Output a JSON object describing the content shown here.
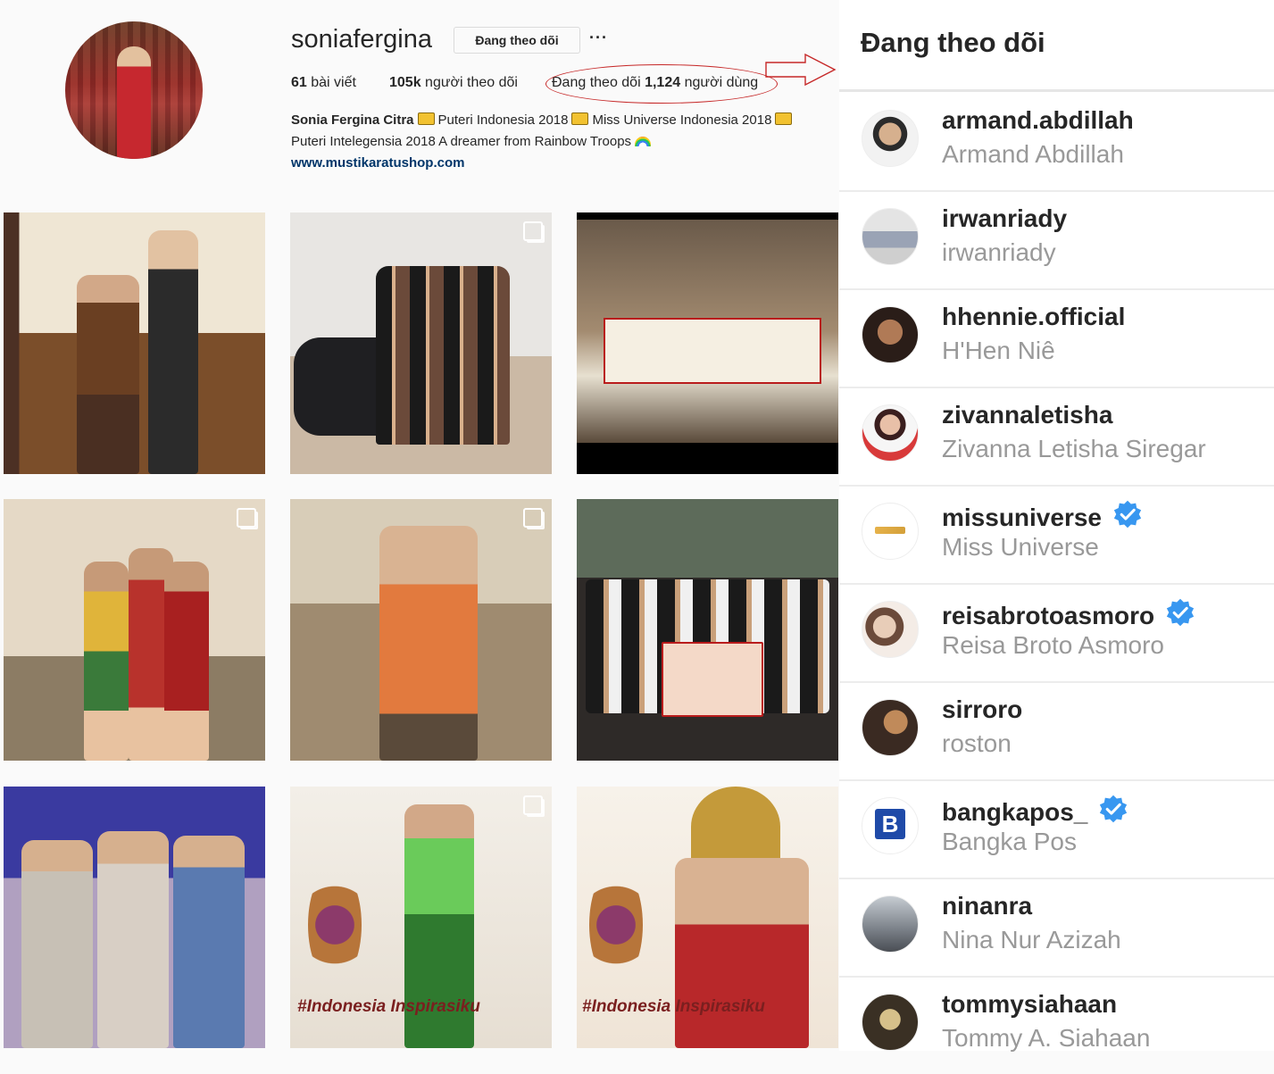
{
  "profile": {
    "username": "soniafergina",
    "follow_label": "Đang theo dõi",
    "more_label": "···",
    "stats": {
      "posts_num": "61",
      "posts_label": " bài viết",
      "followers_num": "105k",
      "followers_label": " người theo dõi",
      "following_prefix": "Đang theo dõi ",
      "following_num": "1,124",
      "following_suffix": " người dùng"
    },
    "bio": {
      "name": "Sonia Fergina Citra",
      "title1": "Puteri Indonesia 2018",
      "title2": "Miss Universe Indonesia 2018",
      "line2": "Puteri Intelegensia 2018 A dreamer from Rainbow Troops",
      "website": "www.mustikaratushop.com"
    },
    "annotation_color": "#c62828"
  },
  "grid": {
    "posts": [
      {
        "caption": ""
      },
      {
        "caption": ""
      },
      {
        "caption": ""
      },
      {
        "caption": ""
      },
      {
        "caption": ""
      },
      {
        "caption": ""
      },
      {
        "caption": ""
      },
      {
        "caption": "#Indonesia Inspirasiku"
      },
      {
        "caption": "#Indonesia Inspirasiku"
      }
    ]
  },
  "following": {
    "title": "Đang theo dõi",
    "verified_color": "#3897f0",
    "users": [
      {
        "username": "armand.abdillah",
        "full_name": "Armand Abdillah",
        "verified": false
      },
      {
        "username": "irwanriady",
        "full_name": "irwanriady",
        "verified": false
      },
      {
        "username": "hhennie.official",
        "full_name": "H'Hen Niê",
        "verified": false
      },
      {
        "username": "zivannaletisha",
        "full_name": "Zivanna Letisha Siregar",
        "verified": false
      },
      {
        "username": "missuniverse",
        "full_name": "Miss Universe",
        "verified": true
      },
      {
        "username": "reisabrotoasmoro",
        "full_name": "Reisa Broto Asmoro",
        "verified": true
      },
      {
        "username": "sirroro",
        "full_name": "roston",
        "verified": false
      },
      {
        "username": "bangkapos_",
        "full_name": "Bangka Pos",
        "verified": true
      },
      {
        "username": "ninanra",
        "full_name": "Nina Nur Azizah",
        "verified": false
      },
      {
        "username": "tommysiahaan",
        "full_name": "Tommy A. Siahaan",
        "verified": false
      }
    ]
  }
}
